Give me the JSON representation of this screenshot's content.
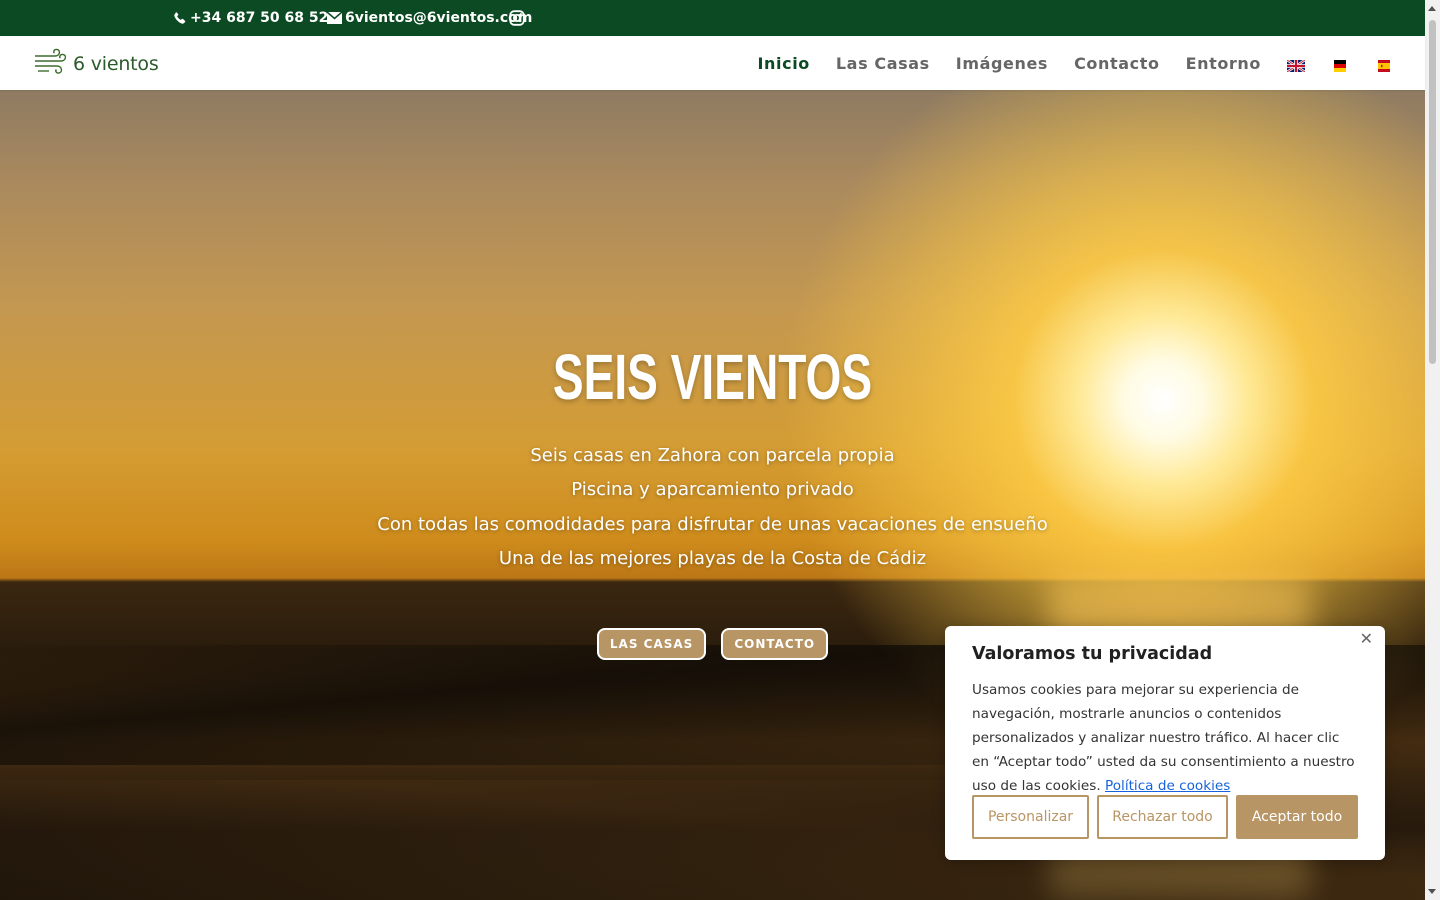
{
  "topbar": {
    "phone": "+34 687 50 68 52",
    "email": "6vientos@6vientos.com",
    "bg_color": "#0b4a22"
  },
  "header": {
    "logo_text": "6 vientos",
    "nav": [
      {
        "label": "Inicio",
        "active": true
      },
      {
        "label": "Las Casas",
        "active": false
      },
      {
        "label": "Imágenes",
        "active": false
      },
      {
        "label": "Contacto",
        "active": false
      },
      {
        "label": "Entorno",
        "active": false
      }
    ],
    "languages": [
      "english-flag-icon",
      "german-flag-icon",
      "spanish-flag-icon"
    ]
  },
  "hero": {
    "title": "SEIS VIENTOS",
    "lines": [
      "Seis casas en Zahora con parcela propia",
      "Piscina y aparcamiento privado",
      "Con todas las comodidades para disfrutar de unas vacaciones de ensueño",
      "Una de las mejores playas de la Costa de Cádiz"
    ],
    "buttons": [
      "LAS CASAS",
      "CONTACTO"
    ]
  },
  "cookie": {
    "title": "Valoramos tu privacidad",
    "text": "Usamos cookies para mejorar su experiencia de navegación, mostrarle anuncios o contenidos personalizados y analizar nuestro tráfico. Al hacer clic en “Aceptar todo” usted da su consentimiento a nuestro uso de las cookies.",
    "policy_link": "Política de cookies",
    "close": "✕",
    "buttons": {
      "customize": "Personalizar",
      "reject": "Rechazar todo",
      "accept": "Aceptar todo"
    },
    "accent_color": "#b89564"
  }
}
